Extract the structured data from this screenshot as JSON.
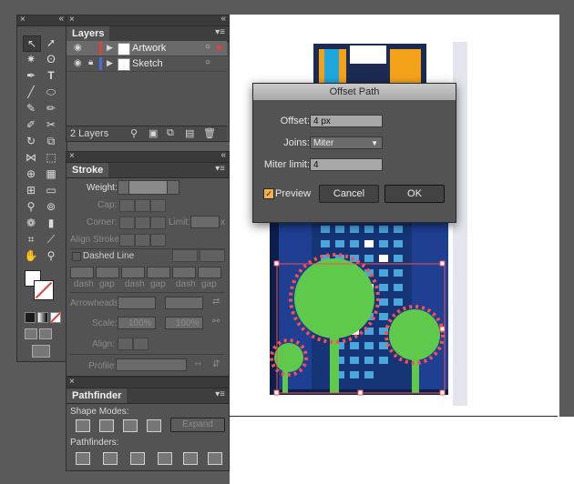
{
  "tools": {
    "icons": [
      "selection-tool",
      "direct-selection-tool",
      "magic-wand-tool",
      "lasso-tool",
      "pen-tool",
      "type-tool",
      "line-tool",
      "ellipse-tool",
      "paintbrush-tool",
      "pencil-tool",
      "blob-brush-tool",
      "scissors-tool",
      "rotate-tool",
      "scale-tool",
      "width-tool",
      "free-transform-tool",
      "shape-builder-tool",
      "chart-tool",
      "mesh-tool",
      "gradient-tool",
      "eyedropper-tool",
      "blend-tool",
      "symbol-sprayer-tool",
      "column-graph-tool",
      "artboard-tool",
      "slice-tool",
      "hand-tool",
      "zoom-tool"
    ]
  },
  "layers": {
    "tab": "Layers",
    "rows": [
      {
        "name": "Artwork",
        "color": "#e0423a"
      },
      {
        "name": "Sketch",
        "color": "#4d6bd8"
      }
    ],
    "count": "2 Layers"
  },
  "stroke": {
    "tab": "Stroke",
    "weight": "Weight:",
    "cap": "Cap:",
    "corner": "Corner:",
    "limit": "Limit:",
    "limit_unit": "x",
    "align_stroke": "Align Stroke:",
    "dashed_line": "Dashed Line",
    "dash": "dash",
    "gap": "gap",
    "arrowheads": "Arrowheads:",
    "scale": "Scale:",
    "scale_a": "100%",
    "scale_b": "100%",
    "align": "Align:",
    "profile": "Profile:"
  },
  "pathfinder": {
    "tab": "Pathfinder",
    "shape_modes": "Shape Modes:",
    "expand": "Expand",
    "pathfinders": "Pathfinders:"
  },
  "dialog": {
    "title": "Offset Path",
    "offset_label": "Offset:",
    "offset_value": "4 px",
    "joins_label": "Joins:",
    "joins_value": "Miter",
    "miter_label": "Miter limit:",
    "miter_value": "4",
    "preview_label": "Preview",
    "cancel": "Cancel",
    "ok": "OK"
  },
  "colors": {
    "accent_selection": "#ff4d4d",
    "palm_green": "#5fc94c",
    "building_blue": "#1e3f92"
  }
}
